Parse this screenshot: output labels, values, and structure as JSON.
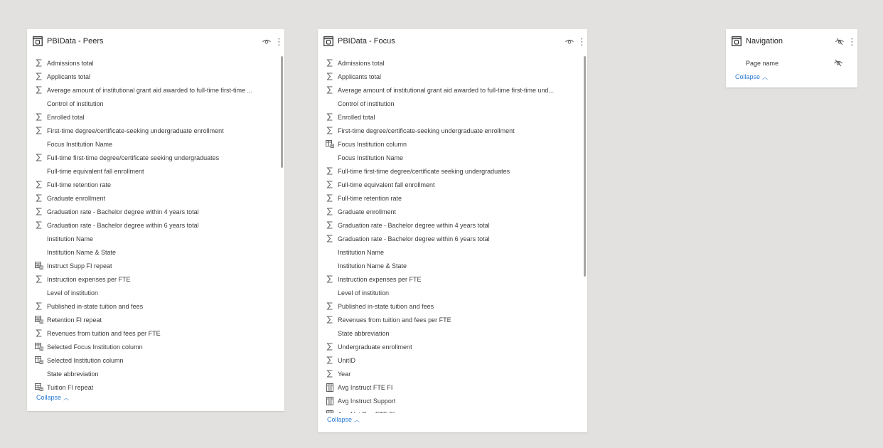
{
  "peers": {
    "title": "PBIData - Peers",
    "collapse": "Collapse",
    "fields": [
      {
        "icon": "sigma",
        "label": "Admissions total"
      },
      {
        "icon": "sigma",
        "label": "Applicants total"
      },
      {
        "icon": "sigma",
        "label": "Average amount of institutional grant aid awarded to full-time first-time ..."
      },
      {
        "icon": "none",
        "label": "Control of institution"
      },
      {
        "icon": "sigma",
        "label": "Enrolled total"
      },
      {
        "icon": "sigma",
        "label": "First-time degree/certificate-seeking undergraduate enrollment"
      },
      {
        "icon": "none",
        "label": "Focus Institution Name"
      },
      {
        "icon": "sigma",
        "label": "Full-time first-time degree/certificate seeking undergraduates"
      },
      {
        "icon": "none",
        "label": "Full-time equivalent fall enrollment"
      },
      {
        "icon": "sigma",
        "label": "Full-time retention rate"
      },
      {
        "icon": "sigma",
        "label": "Graduate enrollment"
      },
      {
        "icon": "sigma",
        "label": "Graduation rate - Bachelor degree within 4 years total"
      },
      {
        "icon": "sigma",
        "label": "Graduation rate - Bachelor degree within 6 years total"
      },
      {
        "icon": "none",
        "label": "Institution Name"
      },
      {
        "icon": "none",
        "label": "Institution Name & State"
      },
      {
        "icon": "calc-table",
        "label": "Instruct Supp FI repeat"
      },
      {
        "icon": "sigma",
        "label": "Instruction expenses per FTE"
      },
      {
        "icon": "none",
        "label": "Level of institution"
      },
      {
        "icon": "sigma",
        "label": "Published in-state tuition and fees"
      },
      {
        "icon": "calc-table",
        "label": "Retention FI repeat"
      },
      {
        "icon": "sigma",
        "label": "Revenues from tuition and fees per FTE"
      },
      {
        "icon": "calc-column",
        "label": "Selected Focus Institution column"
      },
      {
        "icon": "calc-column",
        "label": "Selected Institution column"
      },
      {
        "icon": "none",
        "label": "State abbreviation"
      },
      {
        "icon": "calc-table",
        "label": "Tuition FI repeat"
      }
    ]
  },
  "focus": {
    "title": "PBIData - Focus",
    "collapse": "Collapse",
    "fields": [
      {
        "icon": "sigma",
        "label": "Admissions total"
      },
      {
        "icon": "sigma",
        "label": "Applicants total"
      },
      {
        "icon": "sigma",
        "label": "Average amount of institutional grant aid awarded to full-time first-time und..."
      },
      {
        "icon": "none",
        "label": "Control of institution"
      },
      {
        "icon": "sigma",
        "label": "Enrolled total"
      },
      {
        "icon": "sigma",
        "label": "First-time degree/certificate-seeking undergraduate enrollment"
      },
      {
        "icon": "calc-column",
        "label": "Focus Institution column"
      },
      {
        "icon": "none",
        "label": "Focus Institution Name"
      },
      {
        "icon": "sigma",
        "label": "Full-time first-time degree/certificate seeking undergraduates"
      },
      {
        "icon": "sigma",
        "label": "Full-time equivalent fall enrollment"
      },
      {
        "icon": "sigma",
        "label": "Full-time retention rate"
      },
      {
        "icon": "sigma",
        "label": "Graduate enrollment"
      },
      {
        "icon": "sigma",
        "label": "Graduation rate - Bachelor degree within 4 years total"
      },
      {
        "icon": "sigma",
        "label": "Graduation rate - Bachelor degree within 6 years total"
      },
      {
        "icon": "none",
        "label": "Institution Name"
      },
      {
        "icon": "none",
        "label": "Institution Name & State"
      },
      {
        "icon": "sigma",
        "label": "Instruction expenses per FTE"
      },
      {
        "icon": "none",
        "label": "Level of institution"
      },
      {
        "icon": "sigma",
        "label": "Published in-state tuition and fees"
      },
      {
        "icon": "sigma",
        "label": "Revenues from tuition and fees per FTE"
      },
      {
        "icon": "none",
        "label": "State abbreviation"
      },
      {
        "icon": "sigma",
        "label": "Undergraduate enrollment"
      },
      {
        "icon": "sigma",
        "label": "UnitID"
      },
      {
        "icon": "sigma",
        "label": "Year"
      },
      {
        "icon": "calculator",
        "label": "Avg Instruct FTE FI"
      },
      {
        "icon": "calculator",
        "label": "Avg Instruct Support"
      },
      {
        "icon": "calculator",
        "label": "Avg Net Rev FTE FI"
      }
    ]
  },
  "navigation": {
    "title": "Navigation",
    "collapse": "Collapse",
    "fields": [
      {
        "icon": "hidden",
        "label": "Page name"
      }
    ]
  },
  "colors": {
    "canvas": "#e2e1df",
    "card": "#ffffff",
    "link": "#2b7cd3",
    "text": "#252423"
  }
}
